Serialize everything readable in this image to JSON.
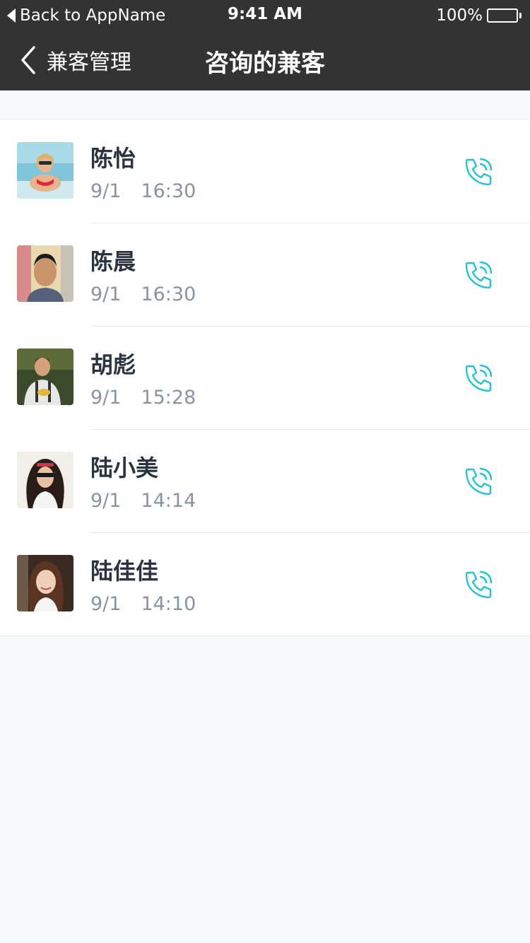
{
  "status_bar": {
    "back_label": "Back to AppName",
    "time": "9:41 AM",
    "battery": "100%"
  },
  "nav": {
    "back_label": "兼客管理",
    "title": "咨询的兼客"
  },
  "colors": {
    "header_bg": "#333333",
    "accent": "#21c5d7",
    "page_bg": "#f7f8fa"
  },
  "contacts": [
    {
      "name": "陈怡",
      "date": "9/1",
      "time": "16:30",
      "avatar": "avatar-photo-1",
      "icon": "phone-call-icon"
    },
    {
      "name": "陈晨",
      "date": "9/1",
      "time": "16:30",
      "avatar": "avatar-photo-2",
      "icon": "phone-call-icon"
    },
    {
      "name": "胡彪",
      "date": "9/1",
      "time": "15:28",
      "avatar": "avatar-photo-3",
      "icon": "phone-call-icon"
    },
    {
      "name": "陆小美",
      "date": "9/1",
      "time": "14:14",
      "avatar": "avatar-photo-4",
      "icon": "phone-call-icon"
    },
    {
      "name": "陆佳佳",
      "date": "9/1",
      "time": "14:10",
      "avatar": "avatar-photo-5",
      "icon": "phone-call-icon"
    }
  ]
}
